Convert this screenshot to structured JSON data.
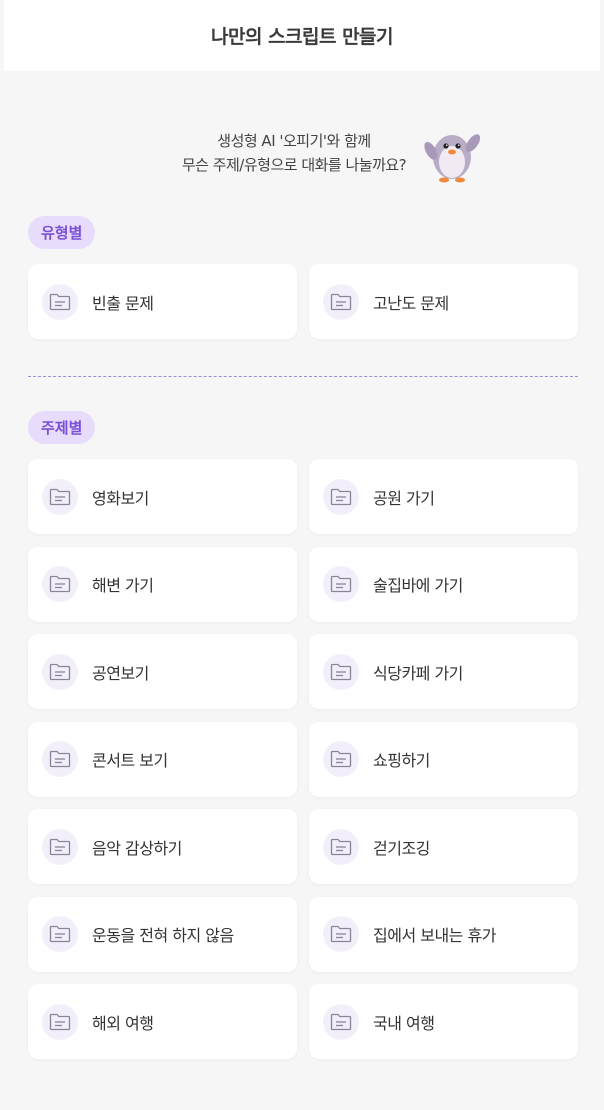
{
  "header": {
    "title": "나만의 스크립트 만들기"
  },
  "intro": {
    "line1": "생성형 AI '오피기'와 함께",
    "line2": "무슨 주제/유형으로 대화를 나눌까요?",
    "mascot_icon": "penguin-mascot-icon"
  },
  "colors": {
    "accent": "#7b4fd6",
    "badge_bg": "#e7dcfb",
    "icon_bg": "#f2effb",
    "background": "#f6f6f7"
  },
  "type_section": {
    "badge": "유형별",
    "items": [
      {
        "label": "빈출 문제",
        "icon": "folder-icon"
      },
      {
        "label": "고난도 문제",
        "icon": "folder-icon"
      }
    ]
  },
  "topic_section": {
    "badge": "주제별",
    "items": [
      {
        "label": "영화보기",
        "icon": "folder-icon"
      },
      {
        "label": "공원 가기",
        "icon": "folder-icon"
      },
      {
        "label": "해변 가기",
        "icon": "folder-icon"
      },
      {
        "label": "술집바에 가기",
        "icon": "folder-icon"
      },
      {
        "label": "공연보기",
        "icon": "folder-icon"
      },
      {
        "label": "식당카페 가기",
        "icon": "folder-icon"
      },
      {
        "label": "콘서트 보기",
        "icon": "folder-icon"
      },
      {
        "label": "쇼핑하기",
        "icon": "folder-icon"
      },
      {
        "label": "음악 감상하기",
        "icon": "folder-icon"
      },
      {
        "label": "걷기조깅",
        "icon": "folder-icon"
      },
      {
        "label": "운동을 전혀 하지 않음",
        "icon": "folder-icon"
      },
      {
        "label": "집에서 보내는 휴가",
        "icon": "folder-icon"
      },
      {
        "label": "해외 여행",
        "icon": "folder-icon"
      },
      {
        "label": "국내 여행",
        "icon": "folder-icon"
      }
    ]
  }
}
